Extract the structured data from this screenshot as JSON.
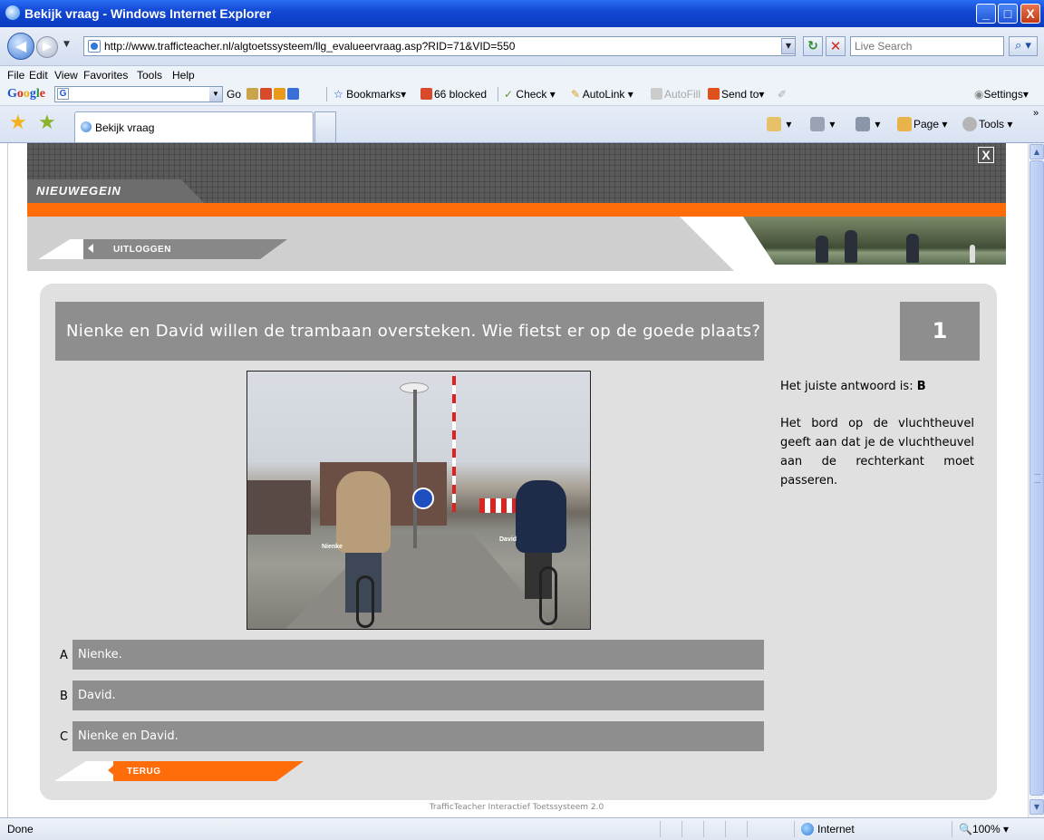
{
  "window": {
    "title": "Bekijk vraag - Windows Internet Explorer",
    "min": "_",
    "max": "□",
    "close": "X"
  },
  "address": {
    "url": "http://www.trafficteacher.nl/algtoetssysteem/llg_evalueervraag.asp?RID=71&VID=550",
    "search_placeholder": "Live Search"
  },
  "menu": [
    "File",
    "Edit",
    "View",
    "Favorites",
    "Tools",
    "Help"
  ],
  "google_toolbar": {
    "go": "Go",
    "bookmarks": "Bookmarks",
    "blocked": "66 blocked",
    "check": "Check",
    "autolink": "AutoLink",
    "autofill": "AutoFill",
    "sendto": "Send to",
    "settings": "Settings"
  },
  "tabs": {
    "active_label": "Bekijk vraag"
  },
  "commands": {
    "page": "Page",
    "tools": "Tools"
  },
  "site": {
    "logo": "NIEUWEGEIN",
    "close": "X",
    "logout": "UITLOGGEN",
    "back": "TERUG",
    "footer": "TrafficTeacher Interactief Toetssysteem 2.0"
  },
  "question": {
    "text": "Nienke en David willen de trambaan oversteken. Wie fietst er op de goede plaats?",
    "number": "1",
    "photo_label_left": "Nienke",
    "photo_label_right": "David",
    "correct_prefix": "Het juiste antwoord is:",
    "correct_letter": "B",
    "explanation": "Het bord op de vluchtheuvel geeft aan dat je de vluchtheuvel aan de rechterkant moet passeren.",
    "options": [
      {
        "letter": "A",
        "text": "Nienke."
      },
      {
        "letter": "B",
        "text": "David."
      },
      {
        "letter": "C",
        "text": "Nienke en David."
      }
    ]
  },
  "status": {
    "left": "Done",
    "zone": "Internet",
    "zoom": "100%"
  }
}
